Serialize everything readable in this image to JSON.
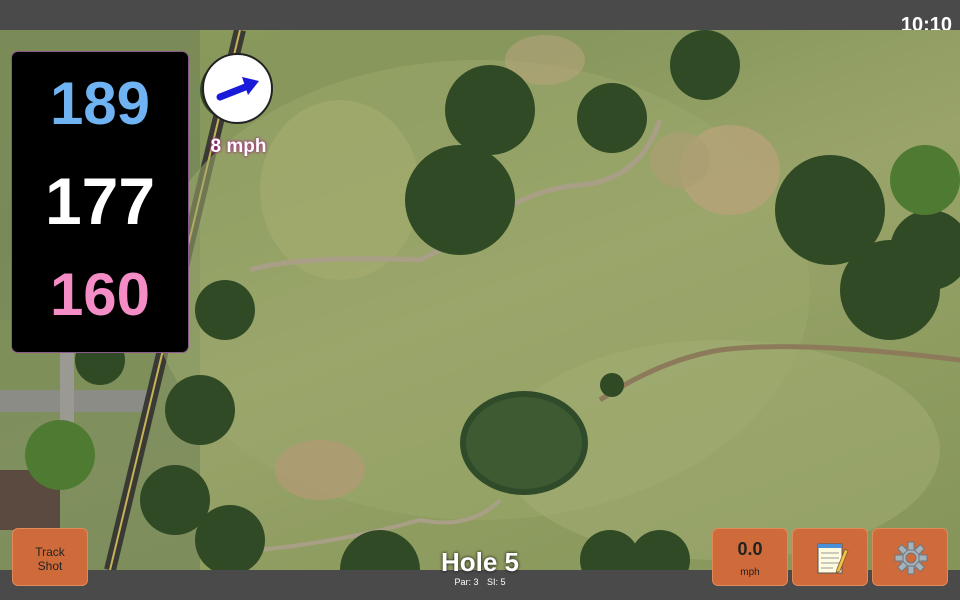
{
  "status": {
    "time": "10:10"
  },
  "distances": {
    "back": "189",
    "middle": "177",
    "front": "160"
  },
  "wind": {
    "speed_label": "8 mph",
    "icon": "wind-arrow-icon",
    "arrow_color": "#1a1adb"
  },
  "hole": {
    "title": "Hole 5",
    "par": "Par: 3",
    "stroke_index": "SI: 5"
  },
  "buttons": {
    "track_shot": "Track\nShot",
    "speed_value": "0.0",
    "speed_unit": "mph",
    "notes_icon": "notepad-icon",
    "settings_icon": "gear-icon"
  },
  "colors": {
    "back_distance": "#6fb3f2",
    "middle_distance": "#ffffff",
    "front_distance": "#f48cc6",
    "button": "#cf6b3b"
  }
}
